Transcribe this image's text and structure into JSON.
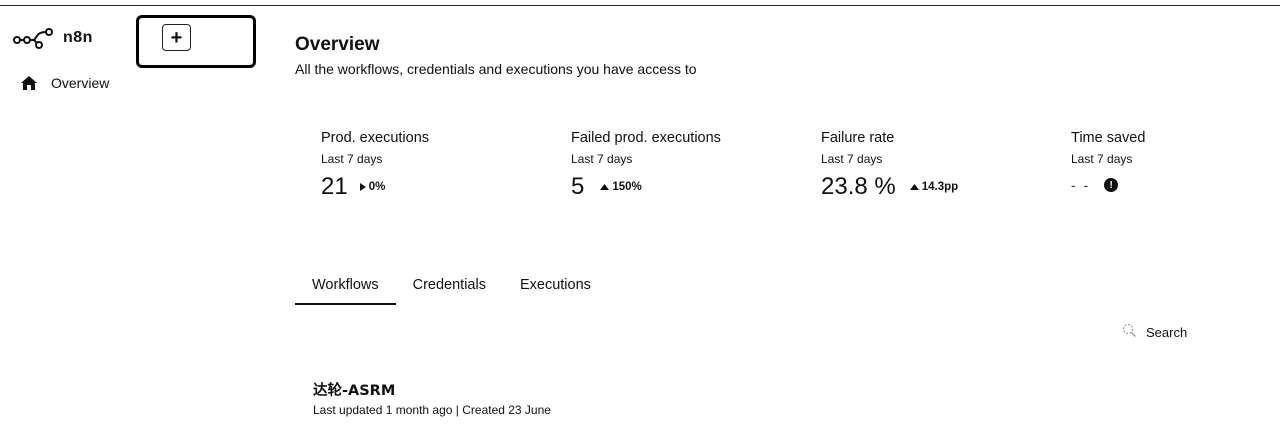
{
  "app": {
    "name": "n8n"
  },
  "sidebar": {
    "items": [
      {
        "label": "Overview",
        "icon": "home-icon"
      }
    ],
    "create_button_label": "+"
  },
  "header": {
    "title": "Overview",
    "subtitle": "All the workflows, credentials and executions you have access to"
  },
  "stats": [
    {
      "label": "Prod. executions",
      "period": "Last 7 days",
      "value": "21",
      "delta": "0%",
      "delta_icon": "caret-right-icon"
    },
    {
      "label": "Failed prod. executions",
      "period": "Last 7 days",
      "value": "5",
      "delta": "150%",
      "delta_icon": "caret-up-icon"
    },
    {
      "label": "Failure rate",
      "period": "Last 7 days",
      "value": "23.8 %",
      "delta": "14.3pp",
      "delta_icon": "caret-up-icon"
    },
    {
      "label": "Time saved",
      "period": "Last 7 days",
      "value": "- -",
      "delta": "",
      "delta_icon": "info-icon"
    }
  ],
  "tabs": [
    {
      "label": "Workflows",
      "active": true
    },
    {
      "label": "Credentials",
      "active": false
    },
    {
      "label": "Executions",
      "active": false
    }
  ],
  "search": {
    "label": "Search"
  },
  "workflows": [
    {
      "name": "达轮-ASRM",
      "meta": "Last updated 1 month ago | Created 23 June"
    }
  ]
}
